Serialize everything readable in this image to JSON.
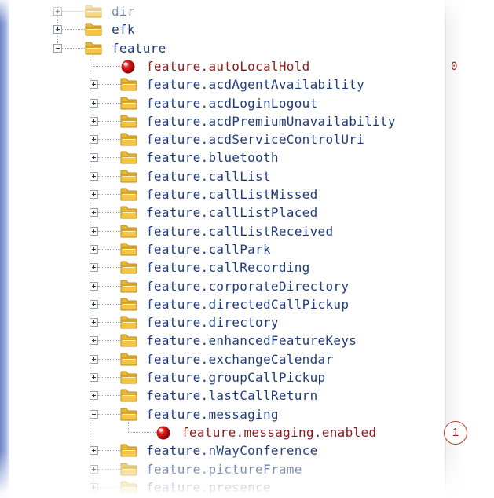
{
  "tree": {
    "nodes": [
      {
        "label": "dir",
        "kind": "folder",
        "expander": "plus",
        "depth": 0
      },
      {
        "label": "efk",
        "kind": "folder",
        "expander": "plus",
        "depth": 0
      },
      {
        "label": "feature",
        "kind": "folder",
        "expander": "minus",
        "depth": 0
      },
      {
        "label": "feature.autoLocalHold",
        "kind": "param",
        "depth": 1,
        "value": "0"
      },
      {
        "label": "feature.acdAgentAvailability",
        "kind": "folder",
        "expander": "plus",
        "depth": 1
      },
      {
        "label": "feature.acdLoginLogout",
        "kind": "folder",
        "expander": "plus",
        "depth": 1
      },
      {
        "label": "feature.acdPremiumUnavailability",
        "kind": "folder",
        "expander": "plus",
        "depth": 1
      },
      {
        "label": "feature.acdServiceControlUri",
        "kind": "folder",
        "expander": "plus",
        "depth": 1
      },
      {
        "label": "feature.bluetooth",
        "kind": "folder",
        "expander": "plus",
        "depth": 1
      },
      {
        "label": "feature.callList",
        "kind": "folder",
        "expander": "plus",
        "depth": 1
      },
      {
        "label": "feature.callListMissed",
        "kind": "folder",
        "expander": "plus",
        "depth": 1
      },
      {
        "label": "feature.callListPlaced",
        "kind": "folder",
        "expander": "plus",
        "depth": 1
      },
      {
        "label": "feature.callListReceived",
        "kind": "folder",
        "expander": "plus",
        "depth": 1
      },
      {
        "label": "feature.callPark",
        "kind": "folder",
        "expander": "plus",
        "depth": 1
      },
      {
        "label": "feature.callRecording",
        "kind": "folder",
        "expander": "plus",
        "depth": 1
      },
      {
        "label": "feature.corporateDirectory",
        "kind": "folder",
        "expander": "plus",
        "depth": 1
      },
      {
        "label": "feature.directedCallPickup",
        "kind": "folder",
        "expander": "plus",
        "depth": 1
      },
      {
        "label": "feature.directory",
        "kind": "folder",
        "expander": "plus",
        "depth": 1
      },
      {
        "label": "feature.enhancedFeatureKeys",
        "kind": "folder",
        "expander": "plus",
        "depth": 1
      },
      {
        "label": "feature.exchangeCalendar",
        "kind": "folder",
        "expander": "plus",
        "depth": 1
      },
      {
        "label": "feature.groupCallPickup",
        "kind": "folder",
        "expander": "plus",
        "depth": 1
      },
      {
        "label": "feature.lastCallReturn",
        "kind": "folder",
        "expander": "plus",
        "depth": 1
      },
      {
        "label": "feature.messaging",
        "kind": "folder",
        "expander": "minus",
        "depth": 1
      },
      {
        "label": "feature.messaging.enabled",
        "kind": "param",
        "depth": 2,
        "value": "1",
        "value_circled": true
      },
      {
        "label": "feature.nWayConference",
        "kind": "folder",
        "expander": "plus",
        "depth": 1
      },
      {
        "label": "feature.pictureFrame",
        "kind": "folder",
        "expander": "plus",
        "depth": 1
      },
      {
        "label": "feature.presence",
        "kind": "folder",
        "expander": "plus",
        "depth": 1
      }
    ]
  },
  "icons": {
    "folder": "folder-icon",
    "param": "red-ball-icon",
    "expand": "plus-expander-icon",
    "collapse": "minus-expander-icon"
  },
  "colors": {
    "node_text": "#1f3c7a",
    "param_text": "#8b1a1a",
    "callout_ring": "#c0392b",
    "folder_fill": "#f3c445",
    "ball_red": "#e01b1b"
  }
}
